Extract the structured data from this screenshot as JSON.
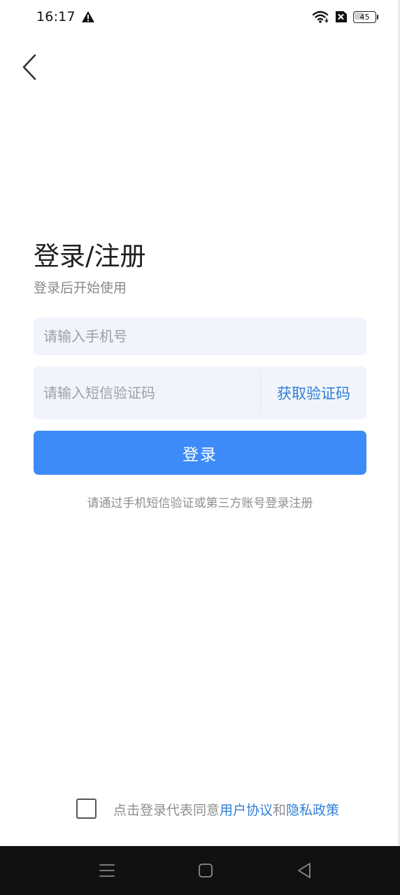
{
  "status_bar": {
    "time": "16:17",
    "battery_level": "45",
    "battery_fraction": 0.45,
    "icons": [
      "warning-icon",
      "wifi-icon",
      "sim-error-icon",
      "battery-icon"
    ]
  },
  "header": {
    "back_icon": "chevron-left-icon"
  },
  "login": {
    "title": "登录/注册",
    "subtitle": "登录后开始使用",
    "phone_placeholder": "请输入手机号",
    "phone_value": "",
    "code_placeholder": "请输入短信验证码",
    "code_value": "",
    "get_code_label": "获取验证码",
    "submit_label": "登录",
    "hint": "请通过手机短信验证或第三方账号登录注册"
  },
  "agreement": {
    "checked": false,
    "prefix": "点击登录代表同意",
    "user_agreement": "用户协议",
    "connector": "和",
    "privacy_policy": "隐私政策"
  },
  "nav_bar": {
    "icons": [
      "menu-icon",
      "home-icon",
      "back-triangle-icon"
    ]
  },
  "colors": {
    "primary": "#3d8bf8",
    "link": "#2f7fd6",
    "input_bg": "#f1f5fb",
    "hint_text": "#8e8e8e"
  }
}
